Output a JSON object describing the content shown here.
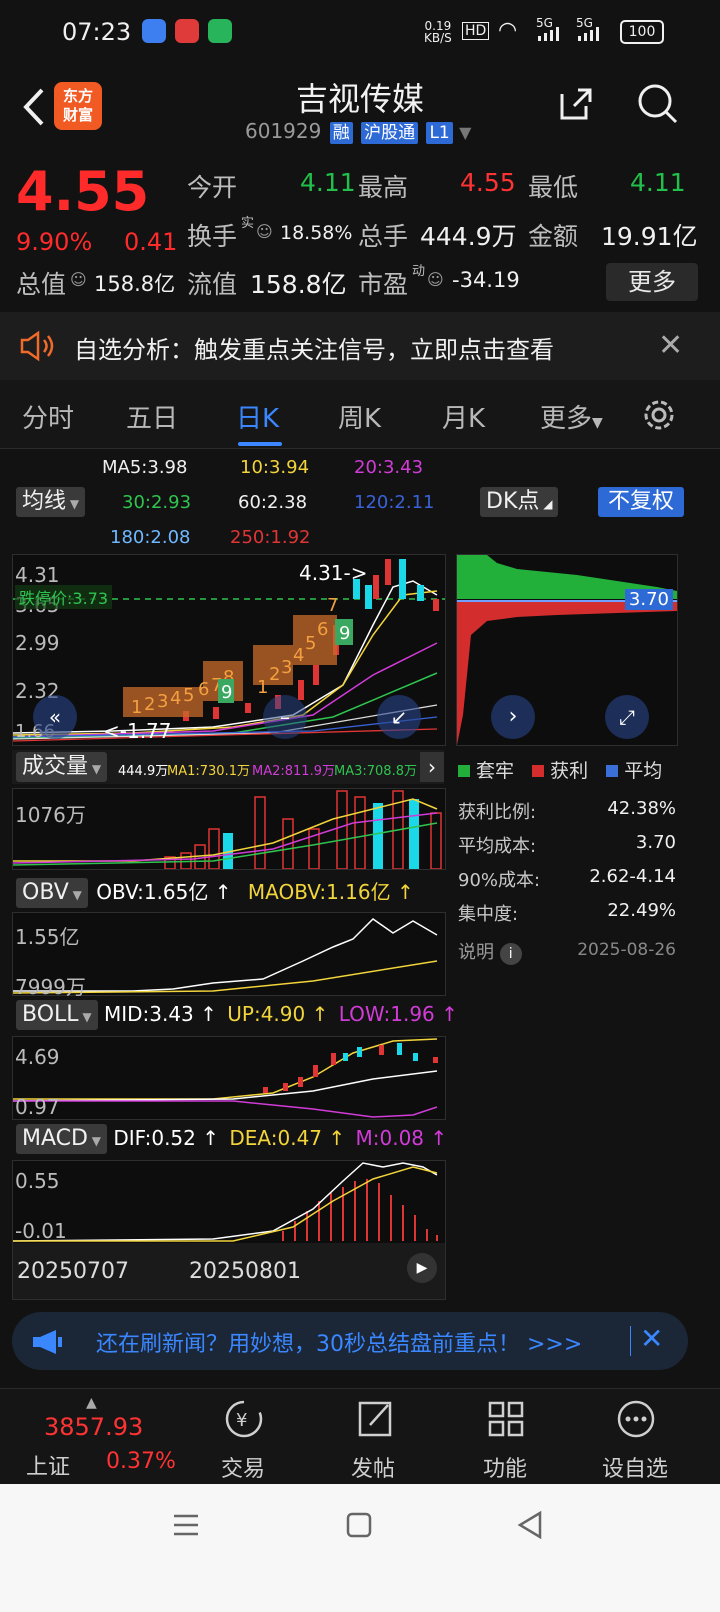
{
  "status_bar": {
    "time": "07:23",
    "net_speed_top": "0.19",
    "net_speed_bottom": "KB/S",
    "hd": "HD",
    "sig1": "5G",
    "sig2": "5G",
    "battery": "100"
  },
  "header": {
    "logo_line1": "东方",
    "logo_line2": "财富",
    "title": "吉视传媒",
    "code": "601929",
    "tags": [
      "融",
      "沪股通",
      "L1"
    ]
  },
  "quote": {
    "price": "4.55",
    "change_pct": "9.90%",
    "change": "0.41",
    "fields": [
      {
        "label": "今开",
        "value": "4.11",
        "color": "green"
      },
      {
        "label": "最高",
        "value": "4.55",
        "color": "red"
      },
      {
        "label": "最低",
        "value": "4.11",
        "color": "green"
      },
      {
        "label": "换手",
        "sup": "实",
        "value": "18.58%",
        "color": "white"
      },
      {
        "label": "总手",
        "value": "444.9万",
        "color": "white"
      },
      {
        "label": "金额",
        "value": "19.91亿",
        "color": "white"
      },
      {
        "label": "总值",
        "value": "158.8亿",
        "color": "white"
      },
      {
        "label": "流值",
        "value": "158.8亿",
        "color": "white"
      },
      {
        "label": "市盈",
        "sup": "动",
        "value": "-34.19",
        "color": "white"
      }
    ],
    "more_label": "更多"
  },
  "notice": {
    "text": "自选分析：触发重点关注信号，立即点击查看"
  },
  "tabs": [
    "分时",
    "五日",
    "日K",
    "周K",
    "月K",
    "更多"
  ],
  "ma_labels": {
    "selector": "均线",
    "ma5": "MA5:3.98",
    "ma10": "10:3.94",
    "ma20": "20:3.43",
    "ma30": "30:2.93",
    "ma60": "60:2.38",
    "ma120": "120:2.11",
    "ma180": "180:2.08",
    "ma250": "250:1.92",
    "dk": "DK点",
    "fuquan": "不复权"
  },
  "kchart": {
    "y_labels": [
      "4.31",
      "3.65",
      "2.99",
      "2.32",
      "1.66"
    ],
    "cost_line": "跌停价:3.73",
    "max_label": "4.31->",
    "min_label": "<-1.77",
    "seq_numbers": [
      "1",
      "2",
      "3",
      "4",
      "5",
      "6",
      "7",
      "8",
      "9",
      "1",
      "2",
      "3",
      "4",
      "5",
      "6",
      "7",
      "8",
      "9"
    ],
    "chip_value": "3.70"
  },
  "volume": {
    "selector": "成交量",
    "vol": "444.9万",
    "ma1": "MA1:730.1万",
    "ma2": "MA2:811.9万",
    "ma3": "MA3:708.8万",
    "y_label": "1076万"
  },
  "obv": {
    "selector": "OBV",
    "obv": "OBV:1.65亿",
    "maobv": "MAOBV:1.16亿",
    "y_top": "1.55亿",
    "y_bottom": "7999万"
  },
  "boll": {
    "selector": "BOLL",
    "mid": "MID:3.43",
    "up": "UP:4.90",
    "low": "LOW:1.96",
    "y_top": "4.69",
    "y_bottom": "0.97"
  },
  "macd": {
    "selector": "MACD",
    "dif": "DIF:0.52",
    "dea": "DEA:0.47",
    "m": "M:0.08",
    "y_top": "0.55",
    "y_bottom": "-0.01",
    "x_start": "20250707",
    "x_mid": "20250801"
  },
  "chips": {
    "legend": [
      "套牢",
      "获利",
      "平均"
    ],
    "rows": [
      {
        "label": "获利比例:",
        "value": "42.38%"
      },
      {
        "label": "平均成本:",
        "value": "3.70"
      },
      {
        "label": "90%成本:",
        "value": "2.62-4.14"
      },
      {
        "label": "集中度:",
        "value": "22.49%"
      }
    ],
    "note_label": "说明",
    "date": "2025-08-26"
  },
  "news_bar": {
    "text": "还在刷新闻？用妙想，30秒总结盘前重点！ >>>"
  },
  "bottom_nav": {
    "index_value": "3857.93",
    "index_name": "上证",
    "index_pct": "0.37%",
    "items": [
      "交易",
      "发帖",
      "功能",
      "设自选"
    ]
  }
}
